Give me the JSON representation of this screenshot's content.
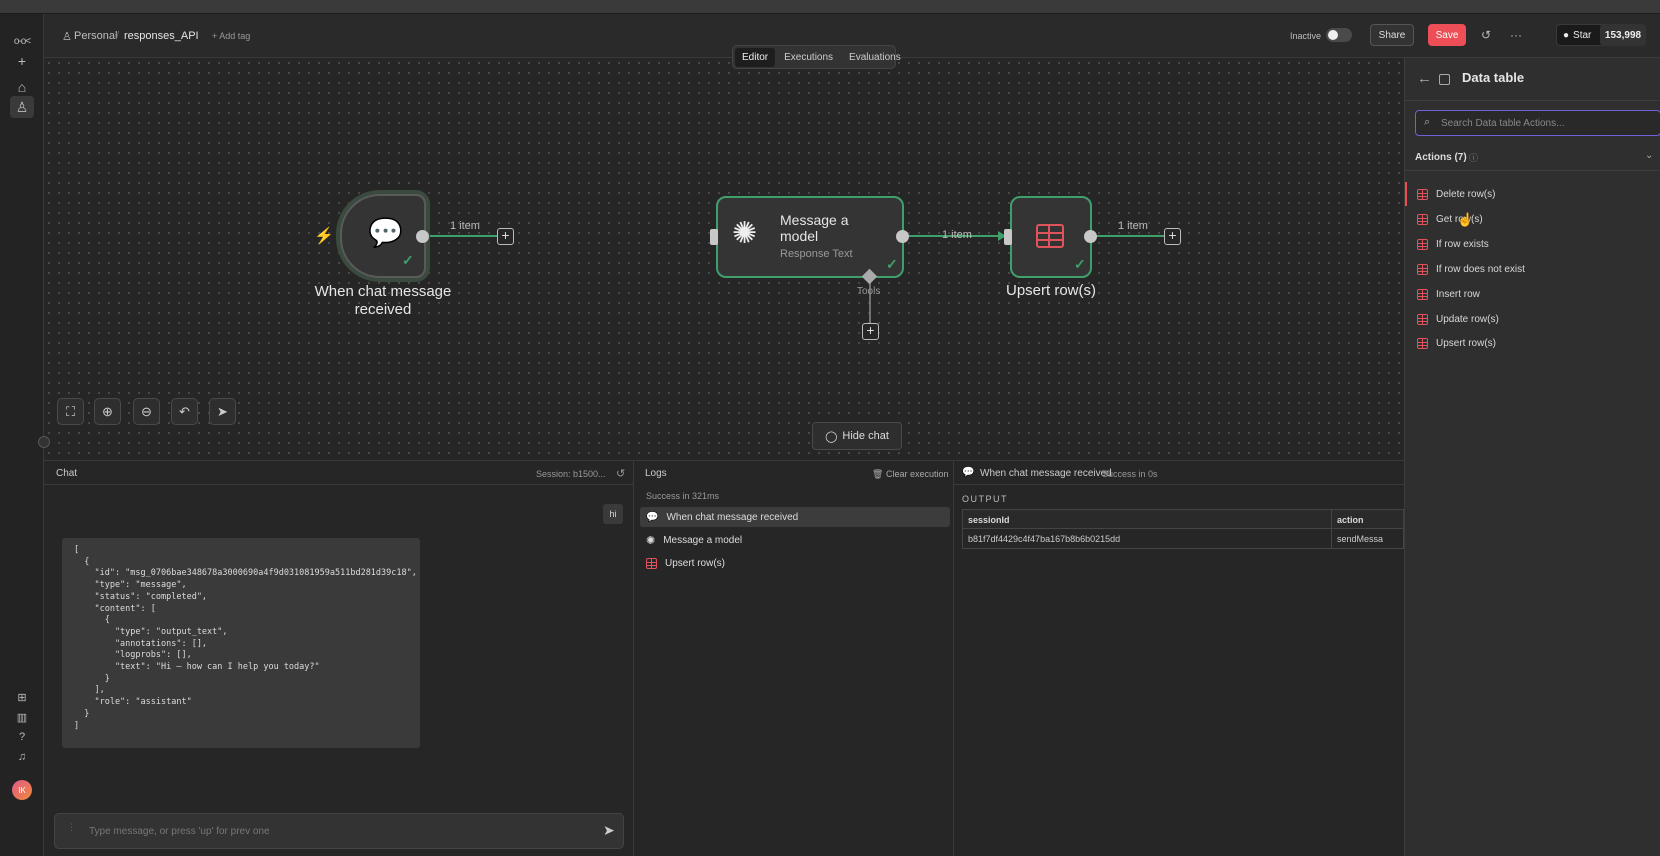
{
  "header": {
    "breadcrumb_owner": "Personal",
    "workflow_name": "responses_API",
    "add_tag": "+ Add tag",
    "inactive_label": "Inactive",
    "share_label": "Share",
    "save_label": "Save",
    "star_label": "Star",
    "star_count": "153,998"
  },
  "tabs": [
    "Editor",
    "Executions",
    "Evaluations"
  ],
  "nodes": {
    "trigger": {
      "title": "When chat message received"
    },
    "model": {
      "title": "Message a model",
      "subtitle": "Response Text",
      "tools_label": "Tools"
    },
    "upsert": {
      "title": "Upsert row(s)"
    }
  },
  "connections": {
    "c1": "1 item",
    "c2": "1 item",
    "c3": "1 item"
  },
  "canvas": {
    "hide_chat": "Hide chat"
  },
  "chat": {
    "title": "Chat",
    "session": "Session: b1500...",
    "user_message": "hi",
    "response_json": "[\n  {\n    \"id\": \"msg_0706bae348678a3000690a4f9d031081959a511bd281d39c18\",\n    \"type\": \"message\",\n    \"status\": \"completed\",\n    \"content\": [\n      {\n        \"type\": \"output_text\",\n        \"annotations\": [],\n        \"logprobs\": [],\n        \"text\": \"Hi — how can I help you today?\"\n      }\n    ],\n    \"role\": \"assistant\"\n  }\n]",
    "input_placeholder": "Type message, or press 'up' for prev one"
  },
  "logs": {
    "title": "Logs",
    "clear": "Clear execution",
    "status": "Success in 321ms",
    "items": [
      "When chat message received",
      "Message a model",
      "Upsert row(s)"
    ]
  },
  "output": {
    "node": "When chat message received",
    "status": "Success in 0s",
    "label": "OUTPUT",
    "columns": [
      "sessionId",
      "action"
    ],
    "row": [
      "b81f7df4429c4f47ba167b8b6b0215dd",
      "sendMessa"
    ]
  },
  "right_panel": {
    "title": "Data table",
    "search_placeholder": "Search Data table Actions...",
    "actions_header": "Actions (7)",
    "actions": [
      "Delete row(s)",
      "Get row(s)",
      "If row exists",
      "If row does not exist",
      "Insert row",
      "Update row(s)",
      "Upsert row(s)"
    ]
  },
  "avatar": "IK",
  "colors": {
    "accent": "#ee4f57",
    "success": "#3fa06b",
    "table_icon": "#e0535b"
  }
}
